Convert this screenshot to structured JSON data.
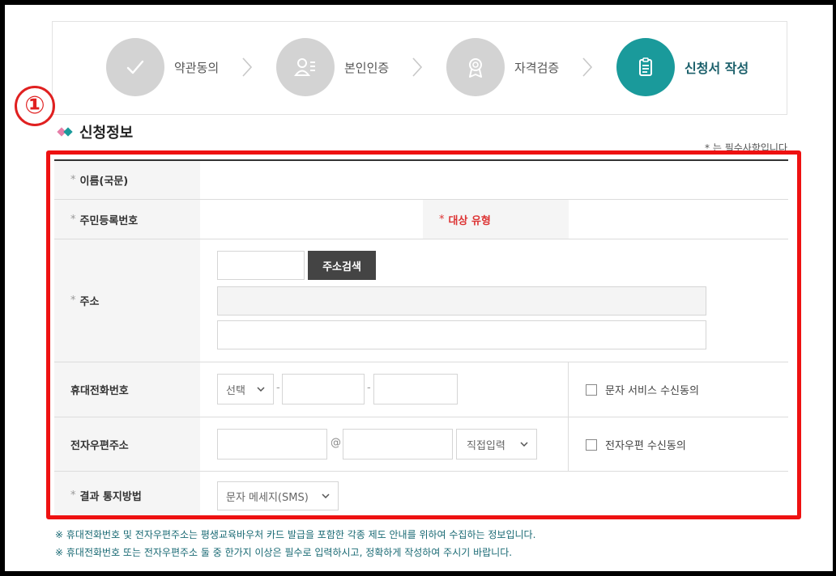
{
  "steps": [
    {
      "label": "약관동의",
      "icon": "check-icon",
      "active": false
    },
    {
      "label": "본인인증",
      "icon": "user-card-icon",
      "active": false
    },
    {
      "label": "자격검증",
      "icon": "medal-icon",
      "active": false
    },
    {
      "label": "신청서 작성",
      "icon": "document-icon",
      "active": true
    }
  ],
  "annotation_badge": "①",
  "section": {
    "title": "신청정보",
    "required_note": "* 는 필수사항입니다"
  },
  "colors": {
    "accent": "#1a9a9b",
    "highlight": "#ee1111",
    "note_text": "#1a6a74",
    "diamond_pink": "#e77fa9",
    "diamond_teal": "#1a9a9b"
  },
  "form": {
    "name": {
      "label": "이름(국문)",
      "required": true,
      "value": ""
    },
    "rrn": {
      "label": "주민등록번호",
      "required": true,
      "value": ""
    },
    "target_type": {
      "label": "대상 유형",
      "required": true,
      "value": ""
    },
    "address": {
      "label": "주소",
      "required": true,
      "postcode": "",
      "search_button": "주소검색",
      "address1": "",
      "address2": ""
    },
    "phone": {
      "label": "휴대전화번호",
      "prefix_selected": "선택",
      "middle": "",
      "last": "",
      "consent_label": "문자 서비스 수신동의",
      "consent_checked": false
    },
    "email": {
      "label": "전자우편주소",
      "local": "",
      "at": "@",
      "domain": "",
      "domain_select": "직접입력",
      "consent_label": "전자우편 수신동의",
      "consent_checked": false
    },
    "notify": {
      "label": "결과 통지방법",
      "required": true,
      "selected": "문자 메세지(SMS)"
    }
  },
  "notes": [
    "※ 휴대전화번호 및 전자우편주소는 평생교육바우처 카드 발급을 포함한 각종 제도 안내를 위하여 수집하는 정보입니다.",
    "※ 휴대전화번호 또는 전자우편주소 둘 중 한가지 이상은 필수로 입력하시고, 정확하게 작성하여 주시기 바랍니다."
  ]
}
